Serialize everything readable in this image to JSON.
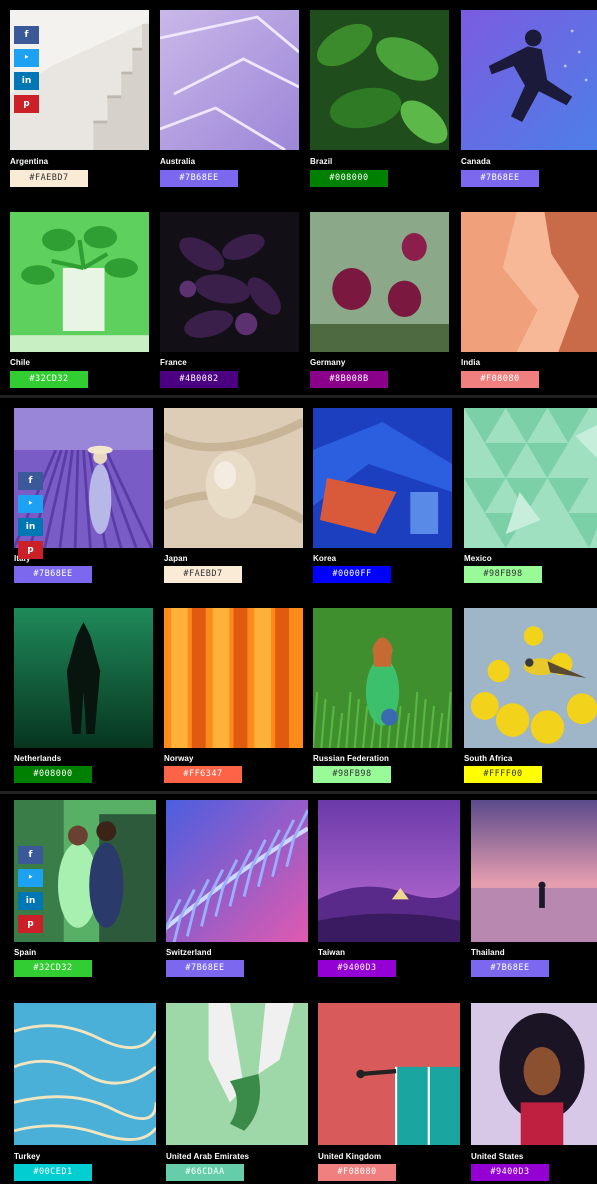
{
  "share": {
    "facebook": "f",
    "twitter": "‣",
    "linkedin": "in",
    "pinterest": "p"
  },
  "tiles": [
    {
      "country": "Argentina",
      "hex": "#FAEBD7",
      "swatch": "#FAEBD7",
      "text": "#333333",
      "scene": "stairs"
    },
    {
      "country": "Australia",
      "hex": "#7B68EE",
      "swatch": "#7B68EE",
      "text": "#ffffff",
      "scene": "salt"
    },
    {
      "country": "Brazil",
      "hex": "#008000",
      "swatch": "#008000",
      "text": "#ffffff",
      "scene": "leaves"
    },
    {
      "country": "Canada",
      "hex": "#7B68EE",
      "swatch": "#7B68EE",
      "text": "#ffffff",
      "scene": "runner"
    },
    {
      "country": "Chile",
      "hex": "#32CD32",
      "swatch": "#32CD32",
      "text": "#ffffff",
      "scene": "greenillu"
    },
    {
      "country": "France",
      "hex": "#4B0082",
      "swatch": "#4B0082",
      "text": "#ffffff",
      "scene": "eggplant"
    },
    {
      "country": "Germany",
      "hex": "#8B008B",
      "swatch": "#8B008B",
      "text": "#ffffff",
      "scene": "cactus"
    },
    {
      "country": "India",
      "hex": "#F08080",
      "swatch": "#F08080",
      "text": "#ffffff",
      "scene": "canyon"
    },
    {
      "country": "Italy",
      "hex": "#7B68EE",
      "swatch": "#7B68EE",
      "text": "#ffffff",
      "scene": "lavender"
    },
    {
      "country": "Japan",
      "hex": "#FAEBD7",
      "swatch": "#FAEBD7",
      "text": "#333333",
      "scene": "egg"
    },
    {
      "country": "Korea",
      "hex": "#0000FF",
      "swatch": "#0000FF",
      "text": "#ffffff",
      "scene": "fabric"
    },
    {
      "country": "Mexico",
      "hex": "#98FB98",
      "swatch": "#98FB98",
      "text": "#333333",
      "scene": "triangles"
    },
    {
      "country": "Netherlands",
      "hex": "#008000",
      "swatch": "#008000",
      "text": "#ffffff",
      "scene": "diver"
    },
    {
      "country": "Norway",
      "hex": "#FF6347",
      "swatch": "#FF6347",
      "text": "#ffffff",
      "scene": "orange"
    },
    {
      "country": "Russian Federation",
      "hex": "#98FB98",
      "swatch": "#98FB98",
      "text": "#333333",
      "scene": "grass"
    },
    {
      "country": "South Africa",
      "hex": "#FFFF00",
      "swatch": "#FFFF00",
      "text": "#333333",
      "scene": "bird"
    },
    {
      "country": "Spain",
      "hex": "#32CD32",
      "swatch": "#32CD32",
      "text": "#ffffff",
      "scene": "couple"
    },
    {
      "country": "Switzerland",
      "hex": "#7B68EE",
      "swatch": "#7B68EE",
      "text": "#ffffff",
      "scene": "palm"
    },
    {
      "country": "Taiwan",
      "hex": "#9400D3",
      "swatch": "#9400D3",
      "text": "#ffffff",
      "scene": "purplescape"
    },
    {
      "country": "Thailand",
      "hex": "#7B68EE",
      "swatch": "#7B68EE",
      "text": "#ffffff",
      "scene": "sunset"
    },
    {
      "country": "Turkey",
      "hex": "#00CED1",
      "swatch": "#00CED1",
      "text": "#ffffff",
      "scene": "terraces"
    },
    {
      "country": "United Arab Emirates",
      "hex": "#66CDAA",
      "swatch": "#66CDAA",
      "text": "#ffffff",
      "scene": "hands"
    },
    {
      "country": "United Kingdom",
      "hex": "#F08080",
      "swatch": "#F08080",
      "text": "#ffffff",
      "scene": "court"
    },
    {
      "country": "United States",
      "hex": "#9400D3",
      "swatch": "#9400D3",
      "text": "#ffffff",
      "scene": "portrait"
    }
  ]
}
